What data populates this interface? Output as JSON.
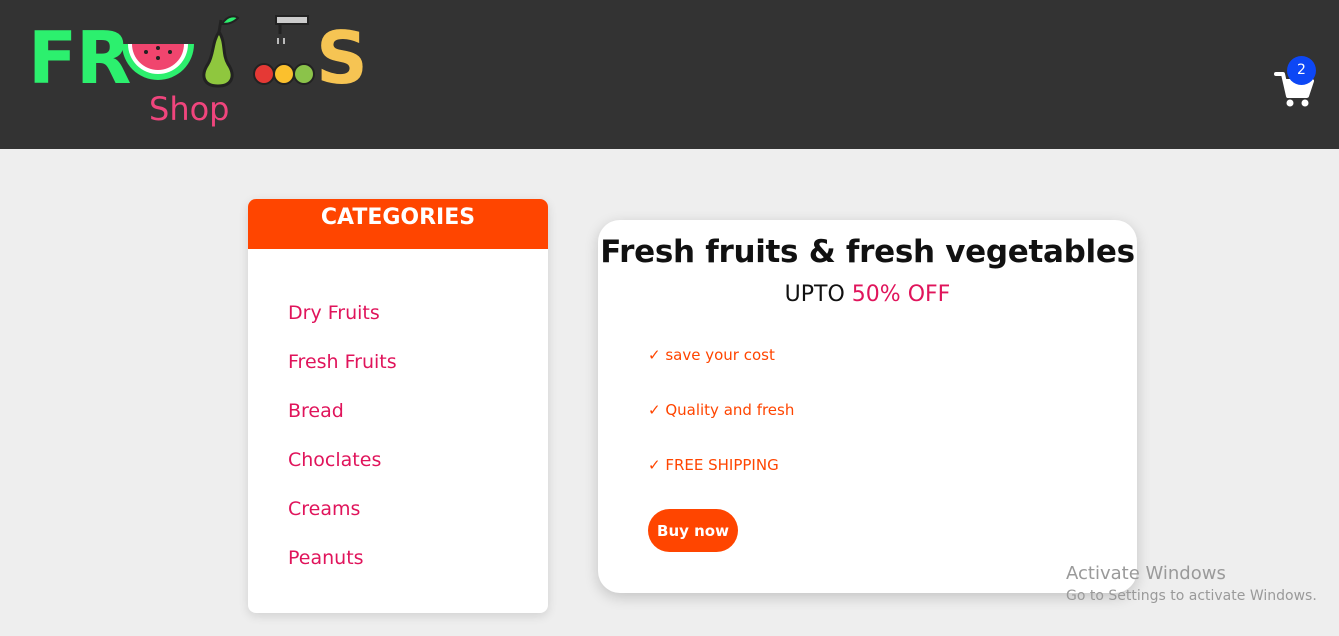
{
  "header": {
    "logo": {
      "letters": [
        "F",
        "R",
        "S"
      ],
      "subtitle": "Shop"
    },
    "cart": {
      "icon": "cart-icon",
      "count": "2"
    }
  },
  "categories": {
    "title": "CATEGORIES",
    "items": [
      "Dry Fruits",
      "Fresh Fruits",
      "Bread",
      "Choclates",
      "Creams",
      "Peanuts"
    ]
  },
  "offer": {
    "title": "Fresh fruits & fresh vegetables",
    "subtitle_prefix": "UPTO ",
    "subtitle_highlight": "50% OFF",
    "features": [
      "✓ save your cost",
      "✓ Quality and fresh",
      "✓ FREE SHIPPING"
    ],
    "button": "Buy now"
  },
  "watermark": {
    "line1": "Activate Windows",
    "line2": "Go to Settings to activate Windows."
  },
  "colors": {
    "header_bg": "#333333",
    "accent": "#ff4500",
    "pink": "#e0145b",
    "badge": "#0d47f5"
  }
}
